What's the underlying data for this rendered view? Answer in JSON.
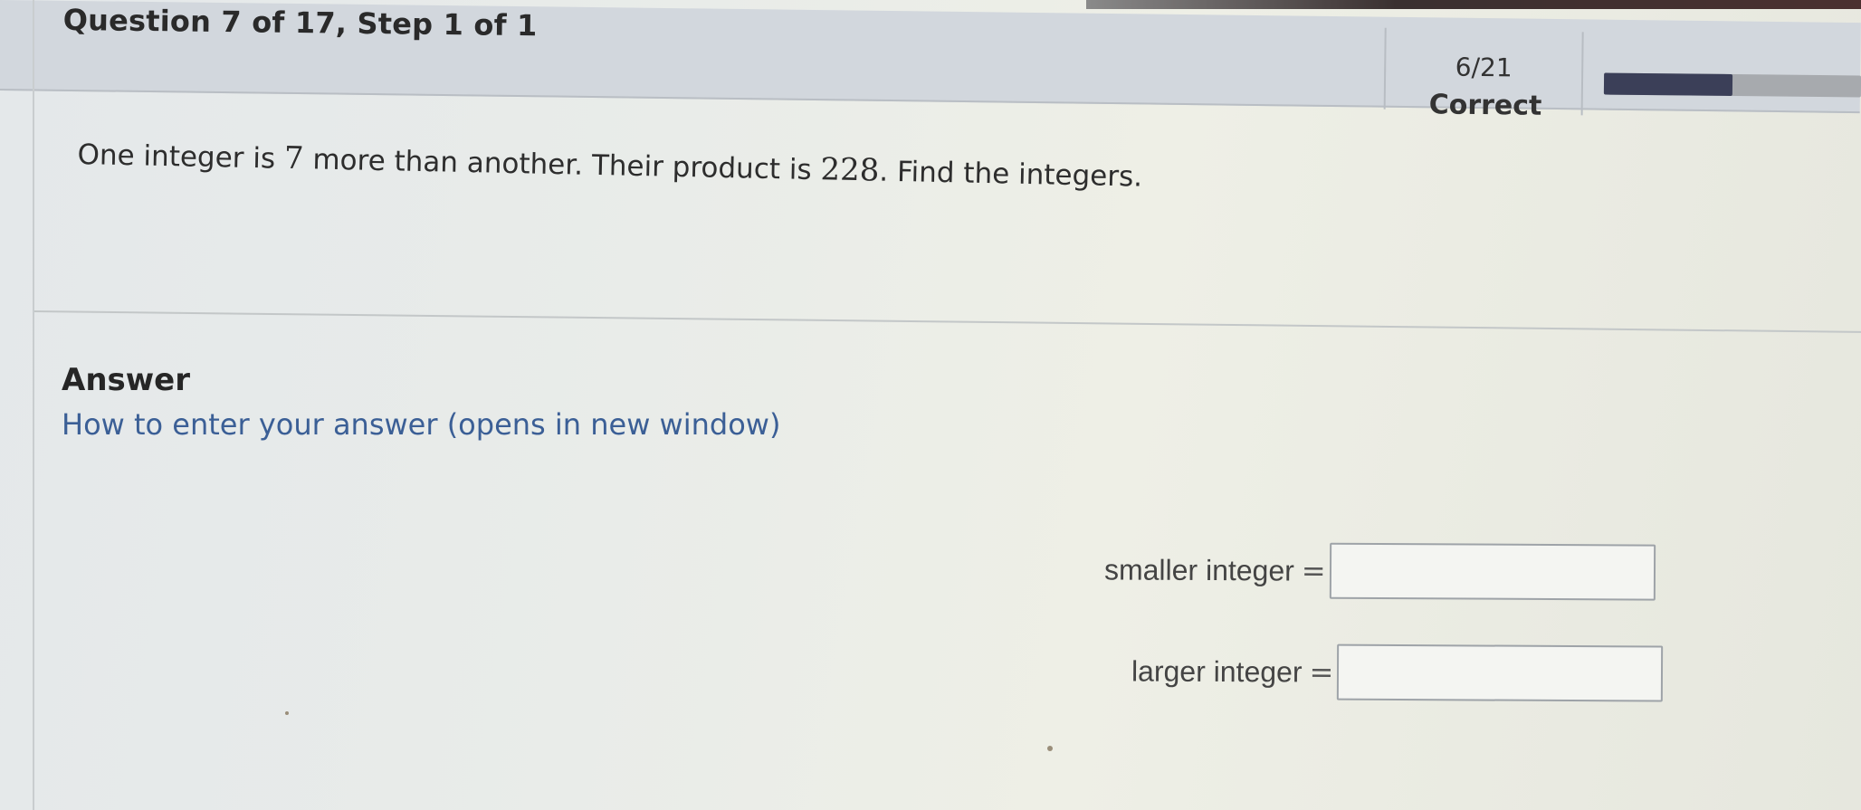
{
  "header": {
    "title": "Question 7 of 17,  Step 1 of 1",
    "score_count": "6/21",
    "score_label": "Correct",
    "progress_fraction": 0.5
  },
  "question": {
    "text_before_1": "One integer is ",
    "num_1": "7",
    "text_between": " more than another.  Their product is ",
    "num_2": "228",
    "text_after": ".  Find the integers."
  },
  "answer": {
    "heading": "Answer",
    "help_link": "How to enter your answer (opens in new window)",
    "fields": [
      {
        "label": "smaller integer",
        "eq": "=",
        "value": ""
      },
      {
        "label": "larger integer",
        "eq": "=",
        "value": ""
      }
    ]
  },
  "colors": {
    "header_bg": "#d2d7dd",
    "link": "#3b5f96",
    "progress_fill": "#3b3f58",
    "progress_track": "#a7aaae"
  }
}
